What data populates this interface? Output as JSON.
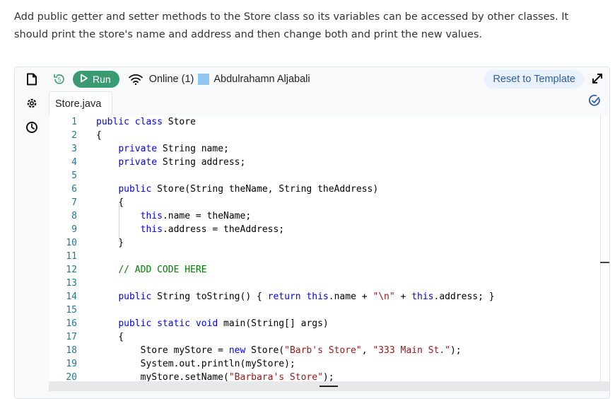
{
  "instructions": "Add public getter and setter methods to the Store class so its variables can be accessed by other classes. It should print the store's name and address and then change both and print the new values.",
  "toolbar": {
    "run_label": "Run",
    "online_label": "Online (1)",
    "user_name": "Abdulrahamn Aljabali",
    "reset_label": "Reset to Template"
  },
  "tab": {
    "filename": "Store.java"
  },
  "icons": {
    "file": "file-icon",
    "settings": "gear-icon",
    "history": "clock-icon",
    "revert": "history-revert-icon",
    "run": "play-icon",
    "wifi": "wifi-icon",
    "expand": "expand-icon",
    "check": "check-circle-icon"
  },
  "colors": {
    "run_button": "#3a9a72",
    "reset_button_bg": "#e9f1fb",
    "reset_button_text": "#2d5fa6",
    "user_swatch": "#8ec5f3",
    "keyword": "#0000ff",
    "string": "#a31515",
    "comment": "#008000",
    "line_number": "#237893"
  },
  "code": [
    {
      "n": "1",
      "segments": [
        {
          "t": "public",
          "c": "kw"
        },
        {
          "t": " "
        },
        {
          "t": "class",
          "c": "kw"
        },
        {
          "t": " Store"
        }
      ]
    },
    {
      "n": "2",
      "segments": [
        {
          "t": "{"
        }
      ]
    },
    {
      "n": "3",
      "segments": [
        {
          "t": "    "
        },
        {
          "t": "private",
          "c": "kw"
        },
        {
          "t": " String name;"
        }
      ]
    },
    {
      "n": "4",
      "segments": [
        {
          "t": "    "
        },
        {
          "t": "private",
          "c": "kw"
        },
        {
          "t": " String address;"
        }
      ]
    },
    {
      "n": "5",
      "segments": []
    },
    {
      "n": "6",
      "segments": [
        {
          "t": "    "
        },
        {
          "t": "public",
          "c": "kw"
        },
        {
          "t": " Store(String theName, String theAddress)"
        }
      ]
    },
    {
      "n": "7",
      "segments": [
        {
          "t": "    {"
        }
      ]
    },
    {
      "n": "8",
      "segments": [
        {
          "t": "        "
        },
        {
          "t": "this",
          "c": "kw"
        },
        {
          "t": ".name = theName;"
        }
      ]
    },
    {
      "n": "9",
      "segments": [
        {
          "t": "        "
        },
        {
          "t": "this",
          "c": "kw"
        },
        {
          "t": ".address = theAddress;"
        }
      ]
    },
    {
      "n": "10",
      "segments": [
        {
          "t": "    }"
        }
      ]
    },
    {
      "n": "11",
      "segments": []
    },
    {
      "n": "12",
      "segments": [
        {
          "t": "    "
        },
        {
          "t": "// ADD CODE HERE",
          "c": "cm"
        }
      ]
    },
    {
      "n": "13",
      "segments": []
    },
    {
      "n": "14",
      "segments": [
        {
          "t": "    "
        },
        {
          "t": "public",
          "c": "kw"
        },
        {
          "t": " String toString() { "
        },
        {
          "t": "return",
          "c": "kw"
        },
        {
          "t": " "
        },
        {
          "t": "this",
          "c": "kw"
        },
        {
          "t": ".name + "
        },
        {
          "t": "\"\\n\"",
          "c": "str"
        },
        {
          "t": " + "
        },
        {
          "t": "this",
          "c": "kw"
        },
        {
          "t": ".address; }"
        }
      ]
    },
    {
      "n": "15",
      "segments": []
    },
    {
      "n": "16",
      "segments": [
        {
          "t": "    "
        },
        {
          "t": "public",
          "c": "kw"
        },
        {
          "t": " "
        },
        {
          "t": "static",
          "c": "kw"
        },
        {
          "t": " "
        },
        {
          "t": "void",
          "c": "kw"
        },
        {
          "t": " main(String[] args)"
        }
      ]
    },
    {
      "n": "17",
      "segments": [
        {
          "t": "    {"
        }
      ]
    },
    {
      "n": "18",
      "segments": [
        {
          "t": "        Store myStore = "
        },
        {
          "t": "new",
          "c": "kw"
        },
        {
          "t": " Store("
        },
        {
          "t": "\"Barb's Store\"",
          "c": "str"
        },
        {
          "t": ", "
        },
        {
          "t": "\"333 Main St.\"",
          "c": "str"
        },
        {
          "t": ");"
        }
      ]
    },
    {
      "n": "19",
      "segments": [
        {
          "t": "        System.out.println(myStore);"
        }
      ]
    },
    {
      "n": "20",
      "segments": [
        {
          "t": "        myStore.setName("
        },
        {
          "t": "\"Barbara's Store\"",
          "c": "str"
        },
        {
          "t": ");"
        }
      ]
    }
  ]
}
